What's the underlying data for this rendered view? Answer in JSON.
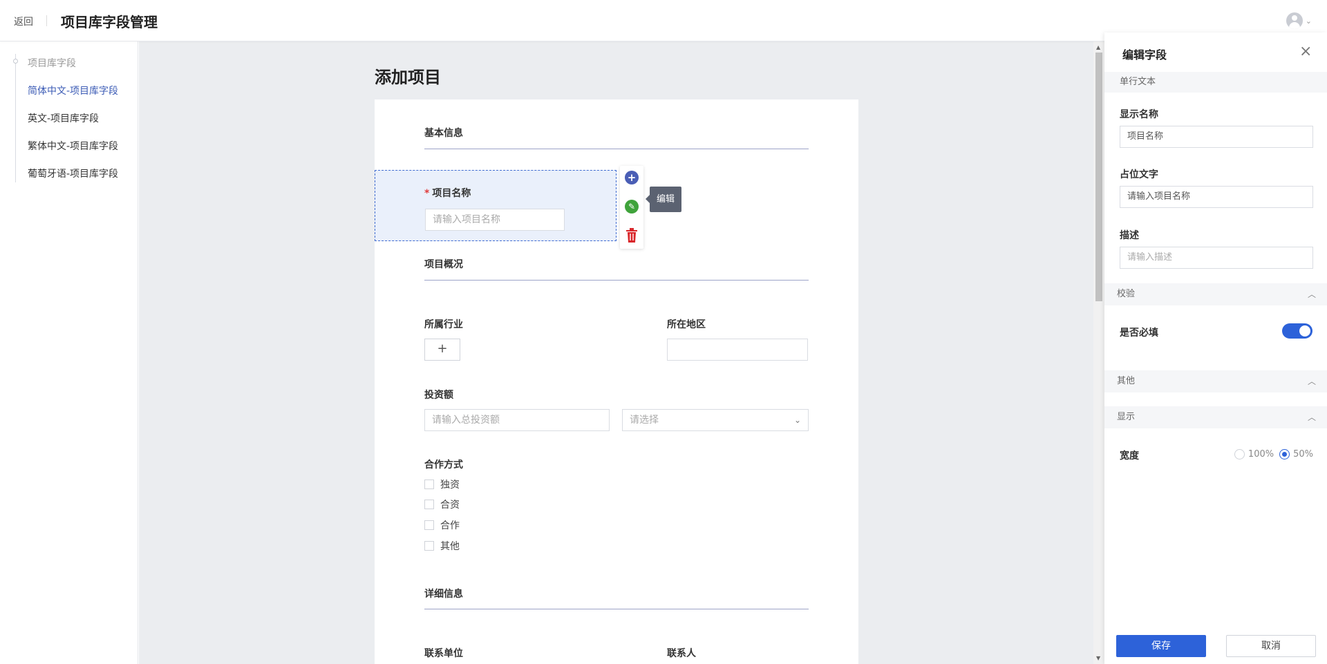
{
  "header": {
    "back_label": "返回",
    "title": "项目库字段管理",
    "avatar_icon": "user-circle-icon",
    "menu_icon": "chevron-down-icon"
  },
  "sidebar": {
    "group_label": "项目库字段",
    "items": [
      {
        "label": "简体中文-项目库字段",
        "active": true
      },
      {
        "label": "英文-项目库字段",
        "active": false
      },
      {
        "label": "繁体中文-项目库字段",
        "active": false
      },
      {
        "label": "葡萄牙语-项目库字段",
        "active": false
      }
    ]
  },
  "form": {
    "title": "添加项目",
    "sections": {
      "basic": "基本信息",
      "overview": "项目概况",
      "detail": "详细信息"
    },
    "fields": {
      "project_name": {
        "label": "项目名称",
        "required_mark": "*",
        "placeholder": "请输入项目名称"
      },
      "industry": {
        "label": "所属行业",
        "add_symbol": "+"
      },
      "region": {
        "label": "所在地区"
      },
      "investment": {
        "label": "投资额",
        "placeholder": "请输入总投资额",
        "unit_placeholder": "请选择"
      },
      "cooperation": {
        "label": "合作方式",
        "options": [
          "独资",
          "合资",
          "合作",
          "其他"
        ]
      },
      "contact_org": {
        "label": "联系单位"
      },
      "contact_person": {
        "label": "联系人"
      }
    },
    "tools": {
      "add_symbol": "+",
      "edit_symbol": "✎",
      "delete_symbol": "🗑",
      "tooltip": "编辑"
    }
  },
  "panel": {
    "title": "编辑字段",
    "close_symbol": "×",
    "field_type": "单行文本",
    "display_name": {
      "label": "显示名称",
      "value": "项目名称"
    },
    "placeholder": {
      "label": "占位文字",
      "value": "请输入项目名称"
    },
    "description": {
      "label": "描述",
      "placeholder": "请输入描述"
    },
    "validation": {
      "section": "校验",
      "required_label": "是否必填",
      "required": true
    },
    "other": {
      "section": "其他"
    },
    "display": {
      "section": "显示",
      "width_label": "宽度",
      "options": [
        "100%",
        "50%"
      ],
      "selected": "50%"
    },
    "save_label": "保存",
    "cancel_label": "取消"
  },
  "colors": {
    "accent": "#2d62d9",
    "active_nav": "#3b5bb5",
    "required": "#e03a3a",
    "delete": "#d9262a",
    "edit": "#3fa33b"
  }
}
